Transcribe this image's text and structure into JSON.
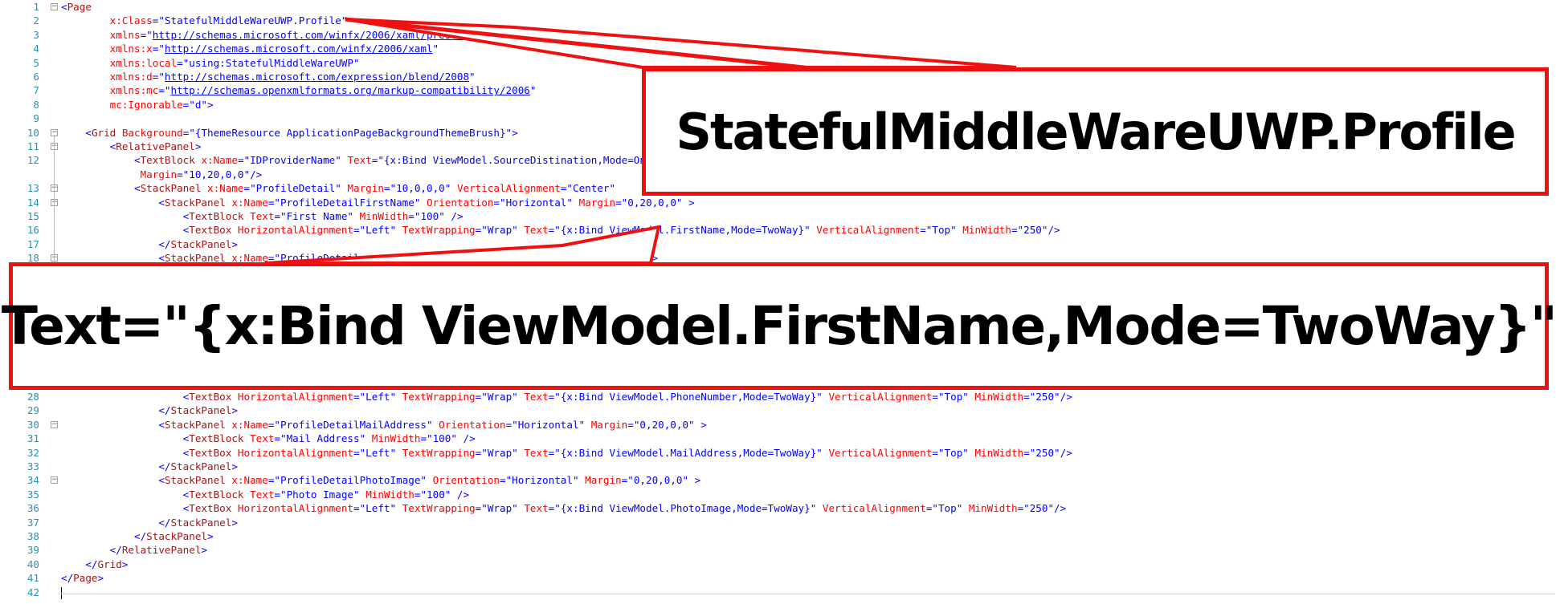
{
  "editor": {
    "lines": [
      {
        "n": "1",
        "fold": "⊟",
        "html": "<span class=\"blue\">&lt;</span><span class=\"brown\">Page</span>"
      },
      {
        "n": "2",
        "html": "        <span class=\"attr\">x:Class</span><span class=\"blue\">=\"StatefulMiddleWareUWP.Profile\"</span>"
      },
      {
        "n": "3",
        "html": "        <span class=\"attr\">xmlns</span><span class=\"blue\">=\"</span><span class=\"link\">http://schemas.microsoft.com/winfx/2006/xaml/presentation</span><span class=\"blue\">\"</span>"
      },
      {
        "n": "4",
        "html": "        <span class=\"attr\">xmlns:x</span><span class=\"blue\">=\"</span><span class=\"link\">http://schemas.microsoft.com/winfx/2006/xaml</span><span class=\"blue\">\"</span>"
      },
      {
        "n": "5",
        "html": "        <span class=\"attr\">xmlns:local</span><span class=\"blue\">=\"using:StatefulMiddleWareUWP\"</span>"
      },
      {
        "n": "6",
        "html": "        <span class=\"attr\">xmlns:d</span><span class=\"blue\">=\"</span><span class=\"link\">http://schemas.microsoft.com/expression/blend/2008</span><span class=\"blue\">\"</span>"
      },
      {
        "n": "7",
        "html": "        <span class=\"attr\">xmlns:mc</span><span class=\"blue\">=\"</span><span class=\"link\">http://schemas.openxmlformats.org/markup-compatibility/2006</span><span class=\"blue\">\"</span>"
      },
      {
        "n": "8",
        "html": "        <span class=\"attr\">mc:Ignorable</span><span class=\"blue\">=\"d\"&gt;</span>"
      },
      {
        "n": "9",
        "html": ""
      },
      {
        "n": "10",
        "fold": "⊟",
        "html": "    <span class=\"blue\">&lt;</span><span class=\"brown\">Grid</span> <span class=\"attr\">Background</span><span class=\"blue\">=\"{ThemeResource ApplicationPageBackgroundThemeBrush}\"&gt;</span>"
      },
      {
        "n": "11",
        "fold": "⊟",
        "html": "        <span class=\"blue\">&lt;</span><span class=\"brown\">RelativePanel</span><span class=\"blue\">&gt;</span>"
      },
      {
        "n": "12",
        "html": "            <span class=\"blue\">&lt;</span><span class=\"brown\">TextBlock</span> <span class=\"attr\">x:Name</span><span class=\"blue\">=\"IDProviderName\"</span> <span class=\"attr\">Text</span><span class=\"blue\">=\"{x:Bind ViewModel.SourceDistination,Mode=OneWay}\"</span>"
      },
      {
        "n": "",
        "html": "             <span class=\"attr\">Margin</span><span class=\"blue\">=\"10,20,0,0\"/&gt;</span>"
      },
      {
        "n": "13",
        "fold": "⊟",
        "html": "            <span class=\"blue\">&lt;</span><span class=\"brown\">StackPanel</span> <span class=\"attr\">x:Name</span><span class=\"blue\">=\"ProfileDetail\"</span> <span class=\"attr\">Margin</span><span class=\"blue\">=\"10,0,0,0\"</span> <span class=\"attr\">VerticalAlignment</span><span class=\"blue\">=\"Center\"</span>"
      },
      {
        "n": "14",
        "fold": "⊟",
        "html": "                <span class=\"blue\">&lt;</span><span class=\"brown\">StackPanel</span> <span class=\"attr\">x:Name</span><span class=\"blue\">=\"ProfileDetailFirstName\"</span> <span class=\"attr\">Orientation</span><span class=\"blue\">=\"Horizontal\"</span> <span class=\"attr\">Margin</span><span class=\"blue\">=\"0,20,0,0\" &gt;</span>"
      },
      {
        "n": "15",
        "html": "                    <span class=\"blue\">&lt;</span><span class=\"brown\">TextBlock</span> <span class=\"attr\">Text</span><span class=\"blue\">=\"First Name\"</span> <span class=\"attr\">MinWidth</span><span class=\"blue\">=\"100\" /&gt;</span>"
      },
      {
        "n": "16",
        "html": "                    <span class=\"blue\">&lt;</span><span class=\"brown\">TextBox</span> <span class=\"attr\">HorizontalAlignment</span><span class=\"blue\">=\"Left\"</span> <span class=\"attr\">TextWrapping</span><span class=\"blue\">=\"Wrap\"</span> <span class=\"attr\">Text</span><span class=\"blue\">=\"{x:Bind ViewModel.FirstName,Mode=TwoWay}\"</span> <span class=\"attr\">VerticalAlignment</span><span class=\"blue\">=\"Top\"</span> <span class=\"attr\">MinWidth</span><span class=\"blue\">=\"250\"/&gt;</span>"
      },
      {
        "n": "17",
        "html": "                <span class=\"blue\">&lt;/</span><span class=\"brown\">StackPanel</span><span class=\"blue\">&gt;</span>"
      },
      {
        "n": "18",
        "fold": "⊟",
        "html": "                <span class=\"blue\">&lt;</span><span class=\"brown\">StackPanel</span> <span class=\"attr\">x:Name</span><span class=\"blue\">=\"ProfileDetail</span>                                        <span class=\"blue\">20,0,0\" &gt;</span>"
      }
    ],
    "lines_lower": [
      {
        "n": "28",
        "html": "                    <span class=\"blue\">&lt;</span><span class=\"brown\">TextBox</span> <span class=\"attr\">HorizontalAlignment</span><span class=\"blue\">=\"Left\"</span> <span class=\"attr\">TextWrapping</span><span class=\"blue\">=\"Wrap\"</span> <span class=\"attr\">Text</span><span class=\"blue\">=\"{x:Bind ViewModel.PhoneNumber,Mode=TwoWay}\"</span> <span class=\"attr\">VerticalAlignment</span><span class=\"blue\">=\"Top\"</span> <span class=\"attr\">MinWidth</span><span class=\"blue\">=\"250\"/&gt;</span>"
      },
      {
        "n": "29",
        "html": "                <span class=\"blue\">&lt;/</span><span class=\"brown\">StackPanel</span><span class=\"blue\">&gt;</span>"
      },
      {
        "n": "30",
        "fold": "⊟",
        "html": "                <span class=\"blue\">&lt;</span><span class=\"brown\">StackPanel</span> <span class=\"attr\">x:Name</span><span class=\"blue\">=\"ProfileDetailMailAddress\"</span> <span class=\"attr\">Orientation</span><span class=\"blue\">=\"Horizontal\"</span> <span class=\"attr\">Margin</span><span class=\"blue\">=\"0,20,0,0\" &gt;</span>"
      },
      {
        "n": "31",
        "html": "                    <span class=\"blue\">&lt;</span><span class=\"brown\">TextBlock</span> <span class=\"attr\">Text</span><span class=\"blue\">=\"Mail Address\"</span> <span class=\"attr\">MinWidth</span><span class=\"blue\">=\"100\" /&gt;</span>"
      },
      {
        "n": "32",
        "html": "                    <span class=\"blue\">&lt;</span><span class=\"brown\">TextBox</span> <span class=\"attr\">HorizontalAlignment</span><span class=\"blue\">=\"Left\"</span> <span class=\"attr\">TextWrapping</span><span class=\"blue\">=\"Wrap\"</span> <span class=\"attr\">Text</span><span class=\"blue\">=\"{x:Bind ViewModel.MailAddress,Mode=TwoWay}\"</span> <span class=\"attr\">VerticalAlignment</span><span class=\"blue\">=\"Top\"</span> <span class=\"attr\">MinWidth</span><span class=\"blue\">=\"250\"/&gt;</span>"
      },
      {
        "n": "33",
        "html": "                <span class=\"blue\">&lt;/</span><span class=\"brown\">StackPanel</span><span class=\"blue\">&gt;</span>"
      },
      {
        "n": "34",
        "fold": "⊟",
        "html": "                <span class=\"blue\">&lt;</span><span class=\"brown\">StackPanel</span> <span class=\"attr\">x:Name</span><span class=\"blue\">=\"ProfileDetailPhotoImage\"</span> <span class=\"attr\">Orientation</span><span class=\"blue\">=\"Horizontal\"</span> <span class=\"attr\">Margin</span><span class=\"blue\">=\"0,20,0,0\" &gt;</span>"
      },
      {
        "n": "35",
        "html": "                    <span class=\"blue\">&lt;</span><span class=\"brown\">TextBlock</span> <span class=\"attr\">Text</span><span class=\"blue\">=\"Photo Image\"</span> <span class=\"attr\">MinWidth</span><span class=\"blue\">=\"100\" /&gt;</span>"
      },
      {
        "n": "36",
        "html": "                    <span class=\"blue\">&lt;</span><span class=\"brown\">TextBox</span> <span class=\"attr\">HorizontalAlignment</span><span class=\"blue\">=\"Left\"</span> <span class=\"attr\">TextWrapping</span><span class=\"blue\">=\"Wrap\"</span> <span class=\"attr\">Text</span><span class=\"blue\">=\"{x:Bind ViewModel.PhotoImage,Mode=TwoWay}\"</span> <span class=\"attr\">VerticalAlignment</span><span class=\"blue\">=\"Top\"</span> <span class=\"attr\">MinWidth</span><span class=\"blue\">=\"250\"/&gt;</span>"
      },
      {
        "n": "37",
        "html": "                <span class=\"blue\">&lt;/</span><span class=\"brown\">StackPanel</span><span class=\"blue\">&gt;</span>"
      },
      {
        "n": "38",
        "html": "            <span class=\"blue\">&lt;/</span><span class=\"brown\">StackPanel</span><span class=\"blue\">&gt;</span>"
      },
      {
        "n": "39",
        "html": "        <span class=\"blue\">&lt;/</span><span class=\"brown\">RelativePanel</span><span class=\"blue\">&gt;</span>"
      },
      {
        "n": "40",
        "html": "    <span class=\"blue\">&lt;/</span><span class=\"brown\">Grid</span><span class=\"blue\">&gt;</span>"
      },
      {
        "n": "41",
        "html": "<span class=\"blue\">&lt;/</span><span class=\"brown\">Page</span><span class=\"blue\">&gt;</span>"
      },
      {
        "n": "42",
        "html": "<span class=\"caret\"></span>"
      }
    ]
  },
  "callouts": {
    "class_name": "StatefulMiddleWareUWP.Profile",
    "binding": "Text=\"{x:Bind ViewModel.FirstName,Mode=TwoWay}\""
  },
  "colors": {
    "callout_border": "#ee1111",
    "tag": "#a31515",
    "attribute": "#ff0000",
    "value": "#0000ff",
    "line_number": "#2b91af"
  }
}
